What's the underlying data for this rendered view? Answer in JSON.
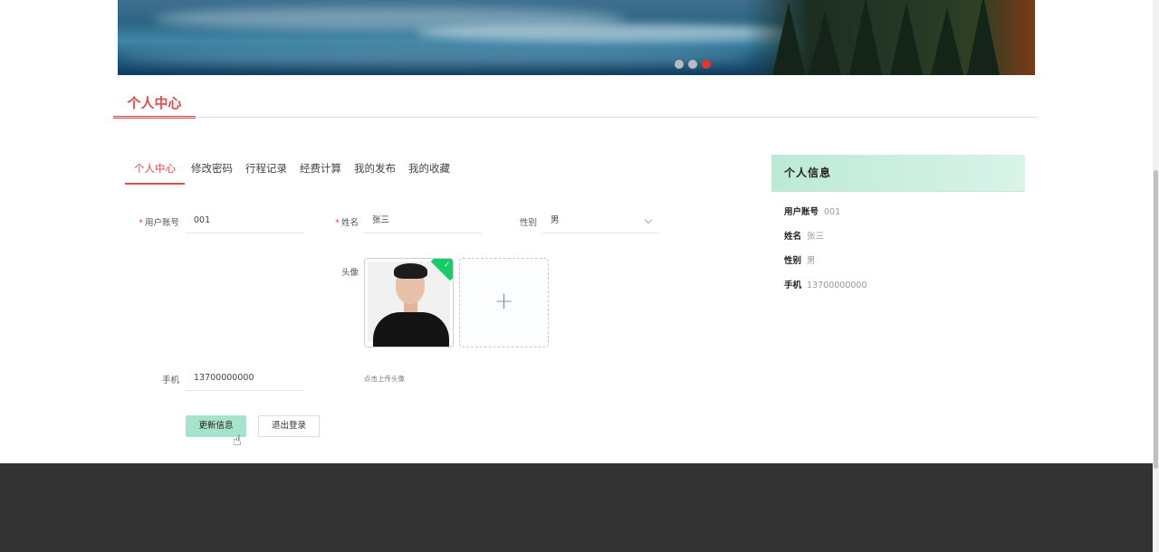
{
  "banner": {
    "active_slide": 3,
    "slide_count": 3
  },
  "section": {
    "title": "个人中心"
  },
  "tabs": [
    {
      "label": "个人中心",
      "active": true
    },
    {
      "label": "修改密码",
      "active": false
    },
    {
      "label": "行程记录",
      "active": false
    },
    {
      "label": "经费计算",
      "active": false
    },
    {
      "label": "我的发布",
      "active": false
    },
    {
      "label": "我的收藏",
      "active": false
    }
  ],
  "form": {
    "account_label": "用户账号",
    "account_value": "001",
    "name_label": "姓名",
    "name_value": "张三",
    "gender_label": "性别",
    "gender_value": "男",
    "avatar_label": "头像",
    "avatar_upload_plus": "+",
    "upload_hint": "点击上传头像",
    "phone_label": "手机",
    "phone_value": "13700000000",
    "required_mark": "*"
  },
  "buttons": {
    "update": "更新信息",
    "logout": "退出登录"
  },
  "profile_card": {
    "title": "个人信息",
    "rows": [
      {
        "key": "用户账号",
        "value": "001"
      },
      {
        "key": "姓名",
        "value": "张三"
      },
      {
        "key": "性别",
        "value": "男"
      },
      {
        "key": "手机",
        "value": "13700000000"
      }
    ]
  },
  "colors": {
    "accent": "#e04c4c",
    "primary_button": "#a6e3cb",
    "card_header": "#bce9d6",
    "footer": "#333333"
  }
}
